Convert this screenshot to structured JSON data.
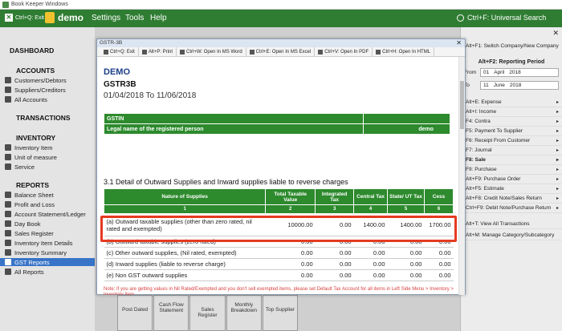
{
  "window_title": "Book Keeper Windows",
  "menubar": {
    "exit_label": "Ctrl+Q: Exit",
    "company": "demo",
    "menus": [
      "Settings",
      "Tools",
      "Help"
    ],
    "search_label": "Ctrl+F: Universal Search"
  },
  "sidebar": {
    "dashboard": "DASHBOARD",
    "accounts_header": "ACCOUNTS",
    "accounts": [
      "Customers/Debtors",
      "Suppliers/Creditors",
      "All Accounts"
    ],
    "transactions_header": "TRANSACTIONS",
    "inventory_header": "INVENTORY",
    "inventory": [
      "Inventory Item",
      "Unit of measure",
      "Service"
    ],
    "reports_header": "REPORTS",
    "reports": [
      "Balance Sheet",
      "Profit and Loss",
      "Account Statement/Ledger",
      "Day Book",
      "Sales Register",
      "Inventory Item Details",
      "Inventory Summary",
      "GST Reports",
      "All Reports"
    ],
    "selected": "GST Reports"
  },
  "background_tiles": [
    "Post Dated",
    "Cash Flow Statement",
    "Sales Register",
    "Monthly Breakdown",
    "Top Supplier"
  ],
  "right_panel": {
    "switch_company": "Alt+F1: Switch Company/New Company",
    "reporting_title": "Alt+F2: Reporting Period",
    "from_label": "From",
    "from_day": "01",
    "from_month": "April",
    "from_year": "2018",
    "to_label": "To",
    "to_day": "11",
    "to_month": "June",
    "to_year": "2018",
    "shortcuts": [
      "Alt+E: Expense",
      "Alt+I: Income",
      "F4: Contra",
      "F5: Payment To Supplier",
      "F6: Receipt From Customer",
      "F7: Journal",
      "F8: Sale",
      "F9: Purchase",
      "Alt+F9: Purchase Order",
      "Alt+F5: Estimate",
      "Alt+F8: Credit Note/Sales Return",
      "Ctrl+F9: Debit Note/Purchase Return"
    ],
    "view_all": "Alt+T: View All Transactions",
    "manage": "Alt+M: Manage Category/Subcategory"
  },
  "report_window": {
    "title": "GSTR-3B",
    "toolbar": [
      "Ctrl+Q: Exit",
      "Alt+P: Print",
      "Ctrl+W: Open In MS Word",
      "Ctrl+E: Open In MS Excel",
      "Ctrl+V: Open In PDF",
      "Ctrl+H: Open In HTML"
    ],
    "company": "DEMO",
    "report_name": "GSTR3B",
    "period": "01/04/2018 To 11/06/2018",
    "gstin_label": "GSTIN",
    "legal_name_label": "Legal name of the registered person",
    "legal_name_value": "demo",
    "section_title": "3.1 Detail of Outward Supplies and Inward supplies liable to reverse charges",
    "columns": [
      "Nature of Supplies",
      "Total Taxable Value",
      "Integrated Tax",
      "Central Tax",
      "State/ UT Tax",
      "Cess"
    ],
    "column_numbers": [
      "1",
      "2",
      "3",
      "4",
      "5",
      "6"
    ],
    "rows": [
      {
        "nature": "(a) Outward taxable supplies (other than zero rated, nil rated and exempted)",
        "values": [
          "10000.00",
          "0.00",
          "1400.00",
          "1400.00",
          "1700.00"
        ]
      },
      {
        "nature": "(b) Outward taxable supplies (zero rated)",
        "values": [
          "0.00",
          "0.00",
          "0.00",
          "0.00",
          "0.00"
        ]
      },
      {
        "nature": "(c) Other outward supplies, (Nil rated, exempted)",
        "values": [
          "0.00",
          "0.00",
          "0.00",
          "0.00",
          "0.00"
        ]
      },
      {
        "nature": "(d) Inward supplies (liable to reverse charge)",
        "values": [
          "0.00",
          "0.00",
          "0.00",
          "0.00",
          "0.00"
        ]
      },
      {
        "nature": "(e) Non GST outward supplies",
        "values": [
          "0.00",
          "0.00",
          "0.00",
          "0.00",
          "0.00"
        ]
      }
    ],
    "note": "Note: If you are getting values in Nil Rated/Exempted and you don't sell exempted items, please set Default Tax Account for all items in Left Side Menu > Inventory > Inventory Item"
  },
  "colors": {
    "brand_green": "#2f7d32",
    "table_green": "#2d8a2d",
    "highlight": "#e53a21",
    "selection": "#3874c7"
  }
}
